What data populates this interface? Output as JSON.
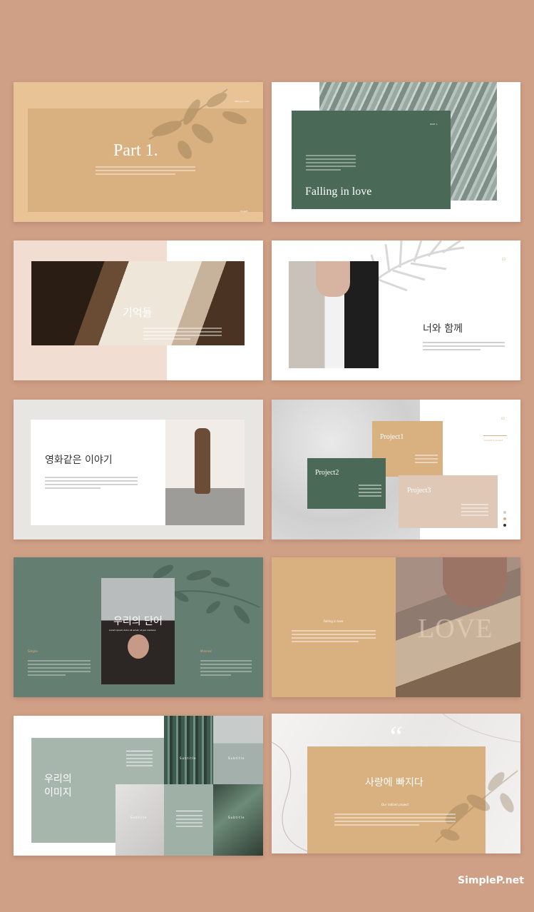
{
  "colors": {
    "background": "#cf9f86",
    "tan": "#d9b07f",
    "green": "#4a6a57",
    "sage": "#657e72",
    "mint": "#a7b6ad",
    "beige": "#dfc9b6"
  },
  "slide1": {
    "title": "Part 1.",
    "label": "Falling in love",
    "page": "Project"
  },
  "slide2": {
    "part": "PART 1.",
    "title": "Falling in love"
  },
  "slide3": {
    "title": "기억들"
  },
  "slide4": {
    "title": "너와 함께",
    "number": "03"
  },
  "slide5": {
    "title": "영화같은 이야기"
  },
  "slide6": {
    "number": "05",
    "subtitle": "Innovative project",
    "projects": [
      "Project1",
      "Project2",
      "Project3"
    ]
  },
  "slide7": {
    "title": "우리의 단어",
    "caption": "Lorem ipsum dolor sit amet, ut per insolens",
    "left_label": "Simple",
    "right_label": "Minimal"
  },
  "slide8": {
    "label": "Falling in love",
    "overlay": "LOVE"
  },
  "slide9": {
    "title_line1": "우리의",
    "title_line2": "이미지",
    "subtitles": [
      "Subtitle",
      "Subtitle",
      "Subtitle",
      "Subtitle"
    ]
  },
  "slide10": {
    "quote": "“",
    "title": "사랑에 빠지다",
    "subtitle": "Our radiant project"
  },
  "watermark": "SimpleP.net"
}
